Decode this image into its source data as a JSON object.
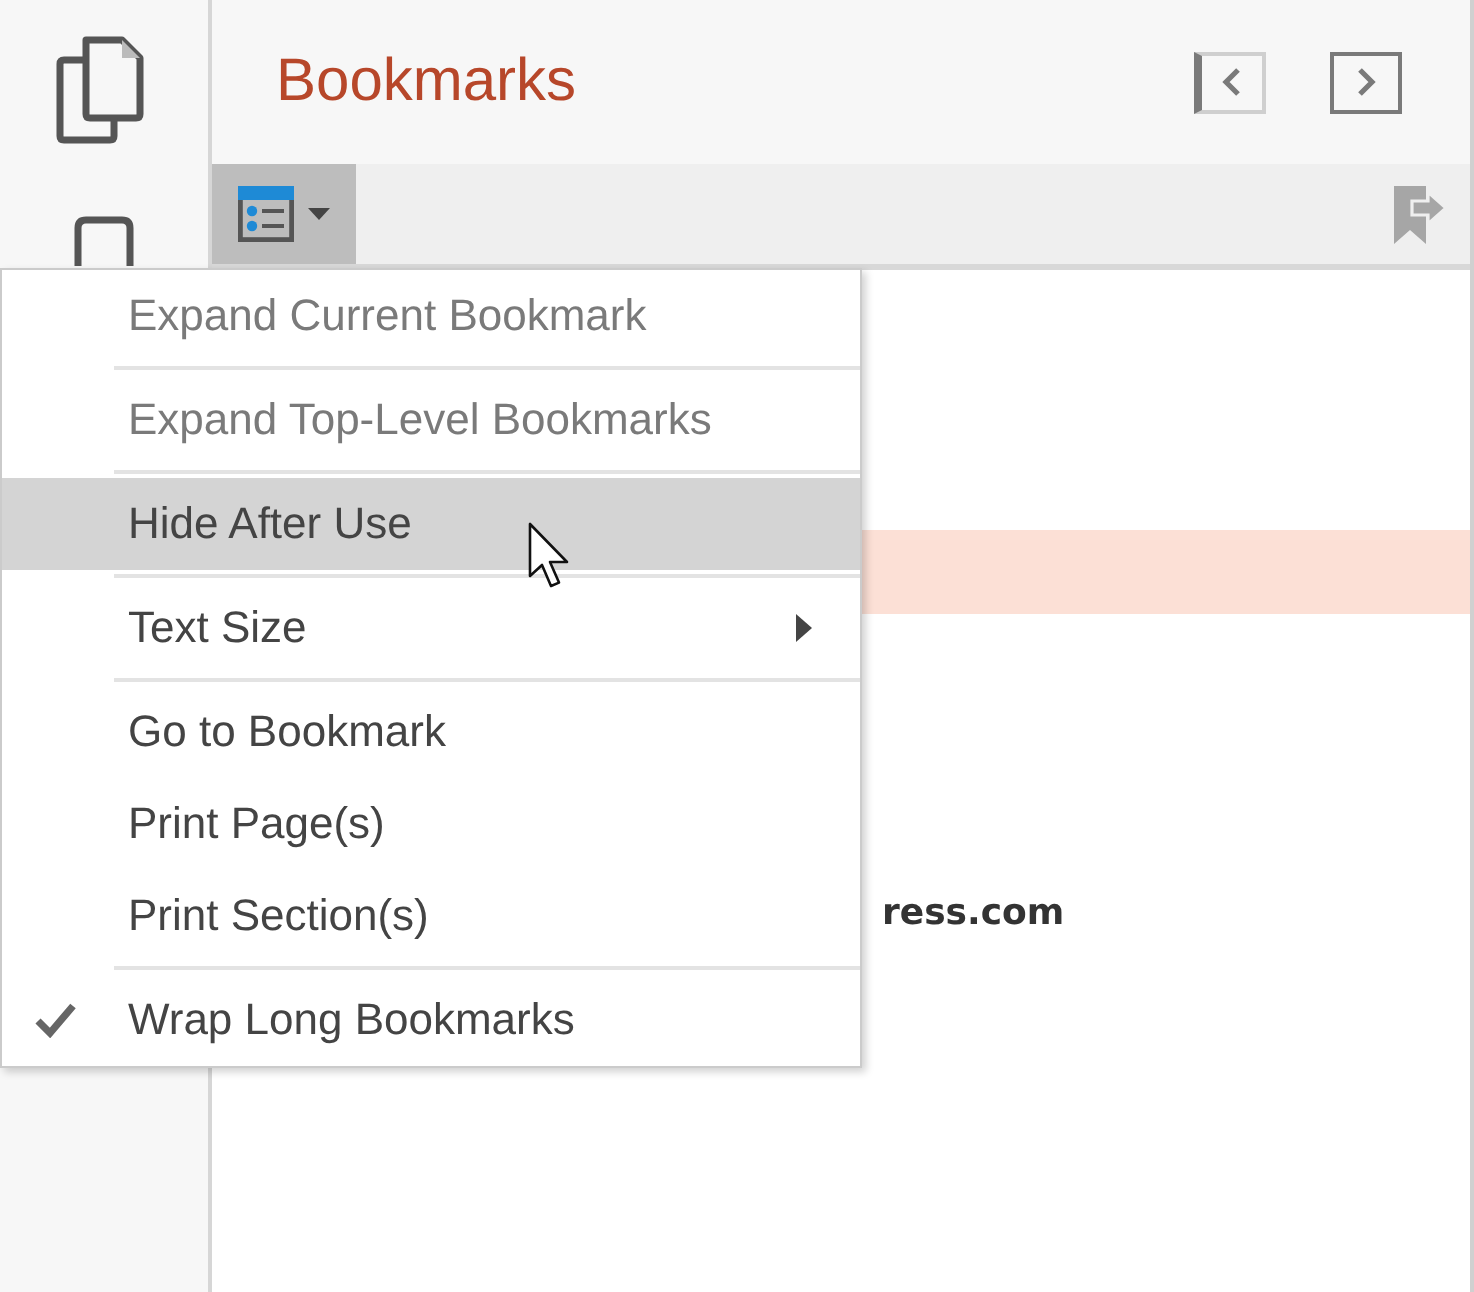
{
  "panel": {
    "title": "Bookmarks",
    "nav_buttons": [
      {
        "kind": "previous",
        "disabled": true
      },
      {
        "kind": "next",
        "disabled": false
      }
    ]
  },
  "toolbar": {
    "options_button": {
      "expanded": true
    }
  },
  "menu": {
    "groups": [
      {
        "items": [
          {
            "label": "Expand Current Bookmark",
            "disabled": true,
            "selected": false,
            "checked": false,
            "submenu": false
          }
        ]
      },
      {
        "items": [
          {
            "label": "Expand Top-Level Bookmarks",
            "disabled": true,
            "selected": false,
            "checked": false,
            "submenu": false
          }
        ]
      },
      {
        "items": [
          {
            "label": "Hide After Use",
            "disabled": false,
            "selected": true,
            "checked": false,
            "submenu": false
          }
        ]
      },
      {
        "items": [
          {
            "label": "Text Size",
            "disabled": false,
            "selected": false,
            "checked": false,
            "submenu": true
          }
        ]
      },
      {
        "items": [
          {
            "label": "Go to Bookmark",
            "disabled": false,
            "selected": false,
            "checked": false,
            "submenu": false
          },
          {
            "label": "Print Page(s)",
            "disabled": false,
            "selected": false,
            "checked": false,
            "submenu": false
          },
          {
            "label": "Print Section(s)",
            "disabled": false,
            "selected": false,
            "checked": false,
            "submenu": false
          }
        ]
      },
      {
        "items": [
          {
            "label": "Wrap Long Bookmarks",
            "disabled": false,
            "selected": false,
            "checked": true,
            "submenu": false
          }
        ]
      }
    ]
  },
  "bookmarks": {
    "rows": [
      {
        "selected": true
      },
      {
        "text": "ress.com",
        "selected": false
      }
    ]
  }
}
